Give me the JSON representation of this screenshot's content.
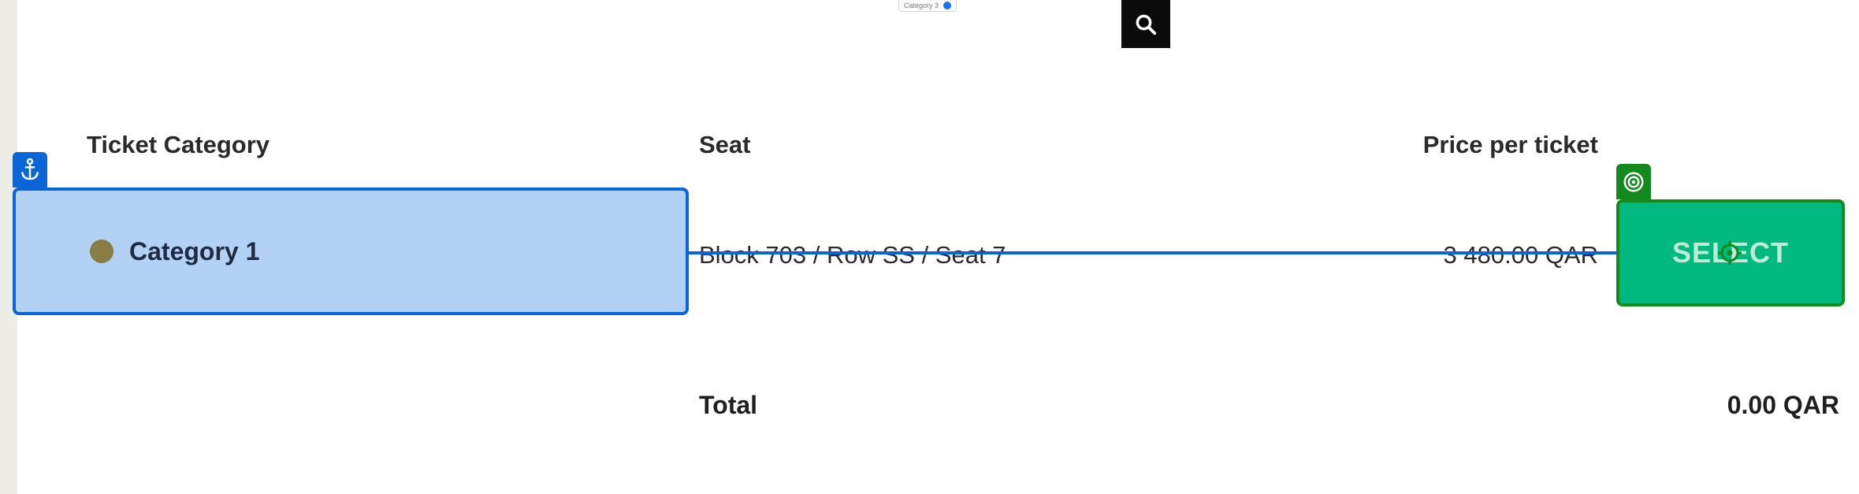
{
  "legend": {
    "label": "Category 3",
    "dot_color": "#1a73e8"
  },
  "search": {
    "icon": "search-icon"
  },
  "table": {
    "headers": {
      "category": "Ticket Category",
      "seat": "Seat",
      "price": "Price per ticket"
    },
    "row": {
      "category": "Category 1",
      "category_color": "#8a7c45",
      "seat": "Block 703 / Row SS / Seat 7",
      "price": "3 480.00 QAR",
      "action": "SELECT"
    }
  },
  "total": {
    "label": "Total",
    "value": "0.00 QAR"
  },
  "colors": {
    "accent_blue": "#0a66d6",
    "select_green": "#00b97e",
    "target_green": "#128a1e"
  },
  "icons": {
    "anchor": "anchor-icon",
    "target": "target-icon",
    "crosshair": "crosshair-icon"
  }
}
